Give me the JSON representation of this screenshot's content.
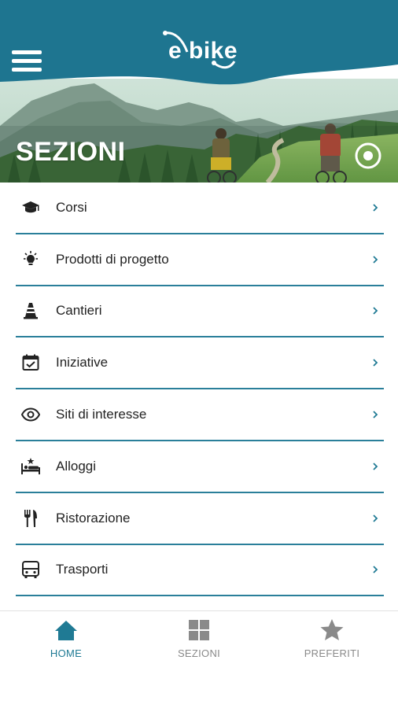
{
  "header": {
    "logo_text": "e bike",
    "brand_color": "#1e7590"
  },
  "hero": {
    "title": "SEZIONI"
  },
  "menu": {
    "items": [
      {
        "label": "Corsi",
        "icon": "graduation-cap-icon"
      },
      {
        "label": "Prodotti di progetto",
        "icon": "lightbulb-icon"
      },
      {
        "label": "Cantieri",
        "icon": "traffic-cone-icon"
      },
      {
        "label": "Iniziative",
        "icon": "calendar-check-icon"
      },
      {
        "label": "Siti di interesse",
        "icon": "eye-icon"
      },
      {
        "label": "Alloggi",
        "icon": "hotel-bed-icon"
      },
      {
        "label": "Ristorazione",
        "icon": "fork-knife-icon"
      },
      {
        "label": "Trasporti",
        "icon": "bus-icon"
      }
    ]
  },
  "bottom_nav": {
    "tabs": [
      {
        "label": "HOME",
        "icon": "home-icon",
        "active": true
      },
      {
        "label": "SEZIONI",
        "icon": "grid-icon",
        "active": false
      },
      {
        "label": "PREFERITI",
        "icon": "star-icon",
        "active": false
      }
    ]
  },
  "colors": {
    "accent": "#1f7a94",
    "divider": "#2a7f9a",
    "inactive": "#8a8a8a"
  }
}
